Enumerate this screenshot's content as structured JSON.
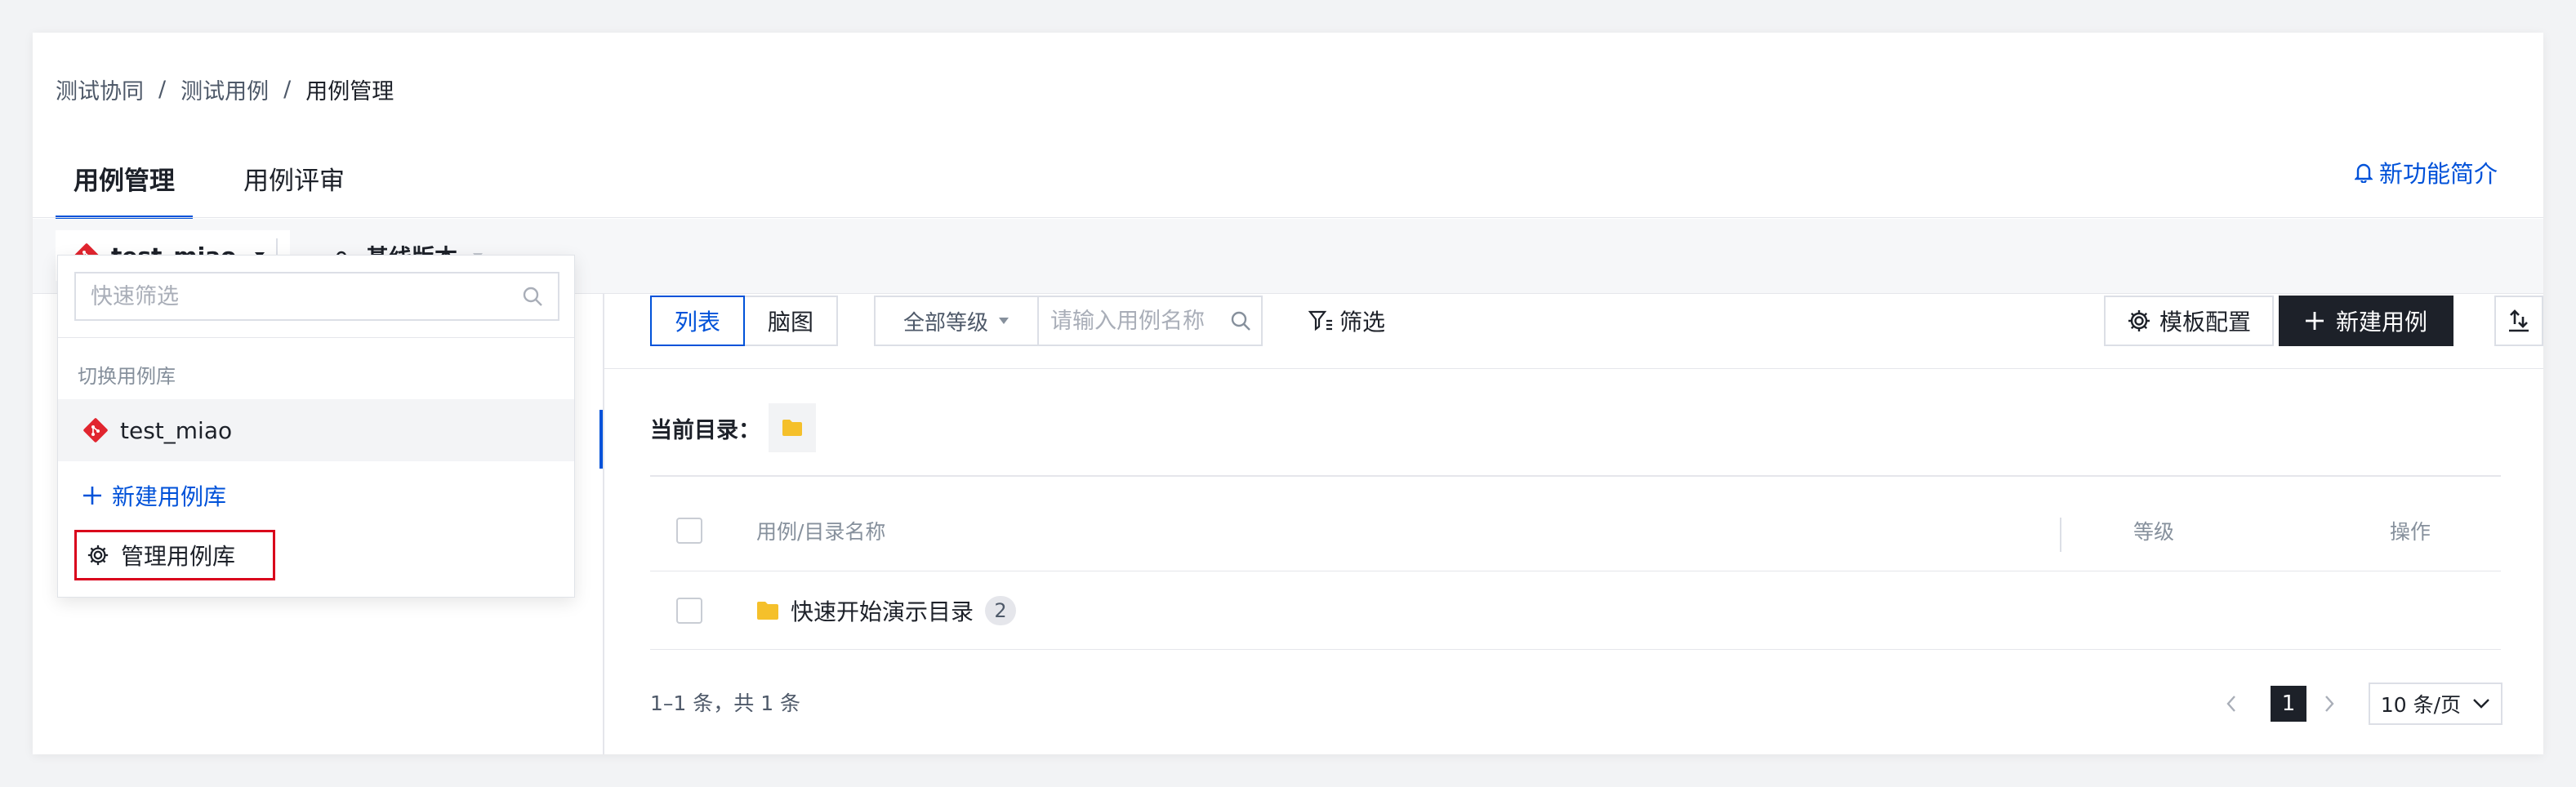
{
  "breadcrumb": {
    "items": [
      "测试协同",
      "测试用例",
      "用例管理"
    ],
    "separator": "/"
  },
  "tabs": [
    {
      "label": "用例管理",
      "active": true
    },
    {
      "label": "用例评审",
      "active": false
    }
  ],
  "header": {
    "new_intro_label": "新功能简介",
    "new_intro_icon": "bell-icon"
  },
  "repo_bar": {
    "repo_name": "test_miao",
    "baseline_label": "基线版本"
  },
  "dropdown": {
    "search_placeholder": "快速筛选",
    "section_title": "切换用例库",
    "repos": [
      {
        "name": "test_miao"
      }
    ],
    "new_repo_label": "新建用例库",
    "manage_repo_label": "管理用例库"
  },
  "toolbar": {
    "view_list_label": "列表",
    "view_mind_label": "脑图",
    "level_select_value": "全部等级",
    "search_placeholder": "请输入用例名称",
    "filter_label": "筛选",
    "template_label": "模板配置",
    "new_case_label": "新建用例"
  },
  "current_dir": {
    "label": "当前目录："
  },
  "table": {
    "columns": [
      "用例/目录名称",
      "等级",
      "操作"
    ],
    "rows": [
      {
        "name": "快速开始演示目录",
        "count": "2"
      }
    ]
  },
  "pagination": {
    "total_text": "1–1 条，共 1 条",
    "current_page": "1",
    "page_size": "10 条/页"
  },
  "colors": {
    "accent": "#0052d9",
    "primary_button": "#1d2129",
    "highlight_border": "#d9001b",
    "folder": "#f5c02b",
    "git_logo": "#e1252f"
  }
}
